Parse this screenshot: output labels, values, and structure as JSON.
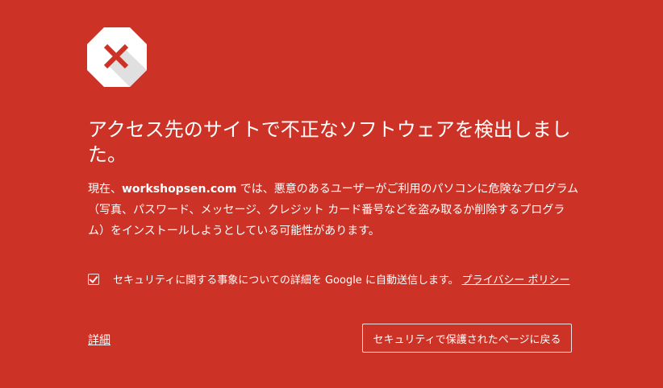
{
  "colors": {
    "background": "#CD3226",
    "icon_background": "#ffffff",
    "icon_mark": "#CD3226",
    "text": "#ffffff"
  },
  "icon": {
    "name": "x-octagon-icon"
  },
  "heading": "アクセス先のサイトで不正なソフトウェアを検出しました。",
  "body": {
    "prefix": "現在、",
    "site": "workshopsen.com",
    "suffix": " では、悪意のあるユーザーがご利用のパソコンに危険なプログラム（写真、パスワード、メッセージ、クレジット カード番号などを盗み取るか削除するプログラム）をインストールしようとしている可能性があります。"
  },
  "optin": {
    "checked": true,
    "label": "セキュリティに関する事象についての詳細を Google に自動送信します。",
    "privacy_link": "プライバシー ポリシー"
  },
  "details_link": "詳細",
  "back_button": "セキュリティで保護されたページに戻る"
}
